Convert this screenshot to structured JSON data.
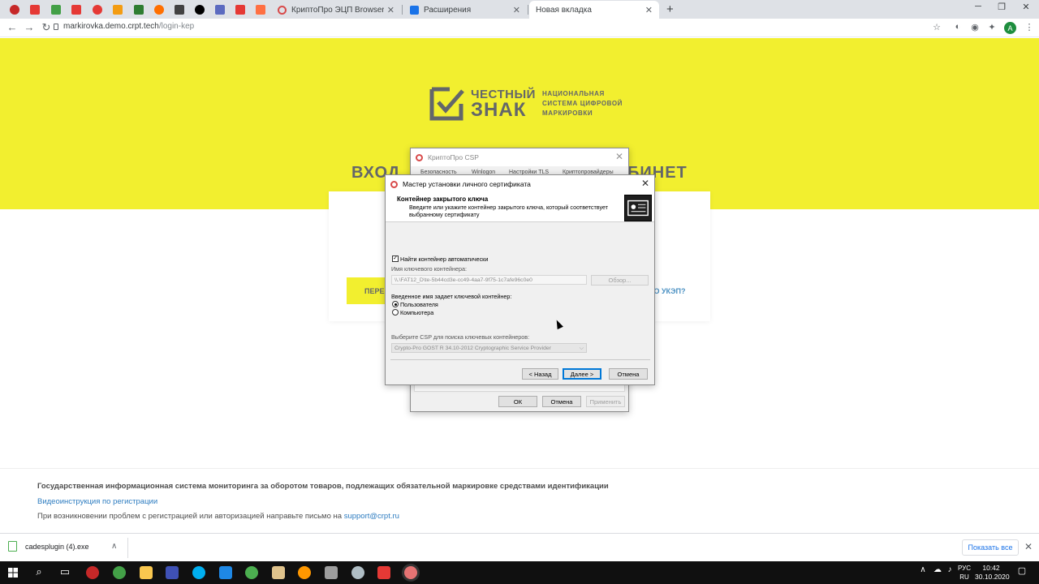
{
  "browser": {
    "tabs": [
      {
        "title": "КриптоПро ЭЦП Browser plug-in",
        "favicon_color": "#d84a4a"
      },
      {
        "title": "Расширения",
        "favicon_color": "#1a73e8"
      },
      {
        "title": "Новая вкладка",
        "favicon_color": "#9aa0a6"
      }
    ],
    "pinned_colors": [
      "#c62828",
      "#e53935",
      "#43a047",
      "#e53935",
      "#e53935",
      "#f39c12",
      "#2e7d32",
      "#ff6f00",
      "#424242",
      "#000000",
      "#5c6bc0",
      "#e53935",
      "#ff7043"
    ],
    "new_tab": "+",
    "url_host": "markirovka.demo.crpt.tech",
    "url_path": "/login-kep",
    "avatar_letter": "A"
  },
  "page": {
    "logo": {
      "line1": "ЧЕСТНЫЙ",
      "line2": "ЗНАК",
      "sub1": "НАЦИОНАЛЬНАЯ",
      "sub2": "СИСТЕМА ЦИФРОВОЙ",
      "sub3": "МАРКИРОВКИ"
    },
    "heading_left": "ВХОД",
    "heading_right": "БИНЕТ",
    "go_button": "ПЕРЕЙ",
    "no_ukep_link": "И ПО УКЭП?",
    "footer": {
      "line1": "Государственная информационная система мониторинга за оборотом товаров, подлежащих обязательной маркировке средствами идентификации",
      "video_link": "Видеоинструкция по регистрации",
      "line3": "При возникновении проблем с регистрацией или авторизацией направьте письмо на",
      "email": "support@crpt.ru"
    }
  },
  "csp_window": {
    "title": "КриптоПро CSP",
    "tabs": [
      "Безопасность",
      "Winlogon",
      "Настройки TLS",
      "Криптопровайдеры"
    ],
    "ok": "ОК",
    "cancel": "Отмена",
    "apply": "Применить"
  },
  "wizard": {
    "title": "Мастер установки личного сертификата",
    "header_title": "Контейнер закрытого ключа",
    "header_desc": "Введите или укажите контейнер закрытого ключа, который соответствует выбранному сертификату",
    "auto_find_label": "Найти контейнер автоматически",
    "auto_find_checked": true,
    "container_name_label": "Имя ключевого контейнера:",
    "container_name_value": "\\\\.\\FAT12_D\\te-5b44cd3e-cc49-4aa7-9f75-1c7afe96c0e0",
    "browse": "Обзор...",
    "name_defines_label": "Введенное имя задает ключевой контейнер:",
    "radio_user": "Пользователя",
    "radio_computer": "Компьютера",
    "selected": "user",
    "csp_select_label": "Выберите CSP для поиска ключевых контейнеров:",
    "csp_select_value": "Crypto-Pro GOST R 34.10-2012 Cryptographic Service Provider",
    "back": "< Назад",
    "next": "Далее >",
    "cancel": "Отмена"
  },
  "download_bar": {
    "file": "cadesplugin (4).exe",
    "show_all": "Показать все"
  },
  "taskbar": {
    "lang_line1": "РУС",
    "lang_line2": "RU",
    "time": "10:42",
    "date": "30.10.2020"
  }
}
